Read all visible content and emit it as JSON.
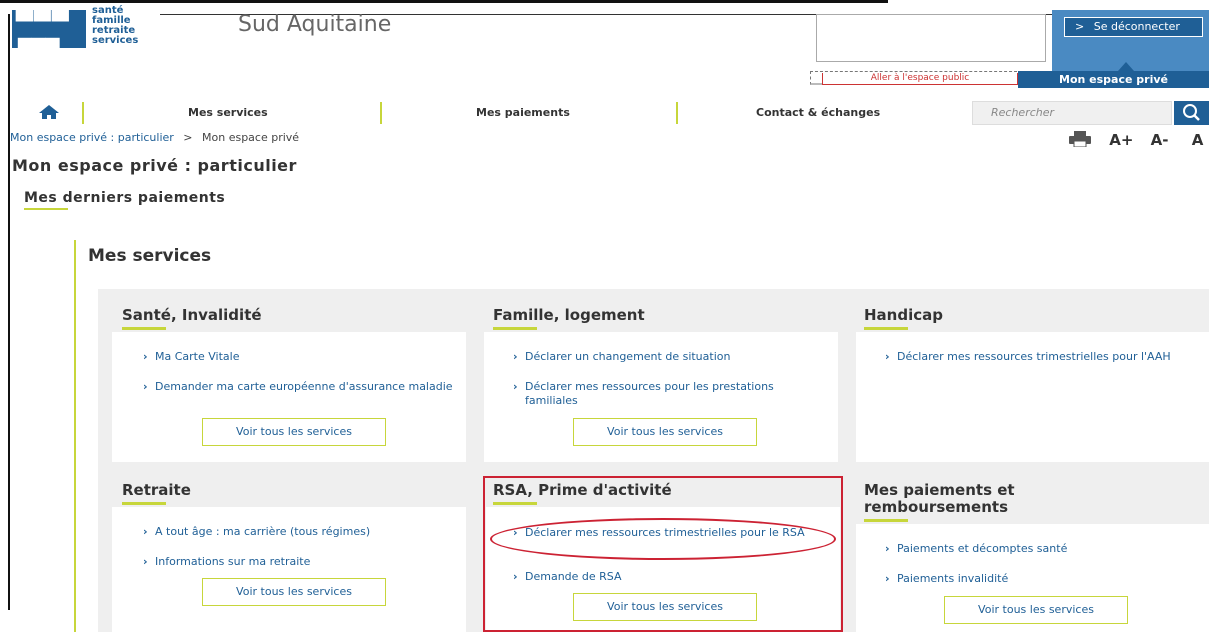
{
  "header": {
    "logo_tagline": [
      "santé",
      "famille",
      "retraite",
      "services"
    ],
    "site_title": "Sud Aquitaine",
    "public_link": "Aller à l'espace public",
    "logout_label": "Se déconnecter",
    "private_space": "Mon espace privé"
  },
  "nav": {
    "items": [
      "Mes services",
      "Mes paiements",
      "Contact & échanges"
    ],
    "search_placeholder": "Rechercher"
  },
  "breadcrumb": {
    "parent": "Mon espace privé : particulier",
    "separator": ">",
    "current": "Mon espace privé"
  },
  "tools": {
    "larger": "A+",
    "smaller": "A-",
    "reset": "A"
  },
  "page": {
    "title": "Mon espace privé : particulier",
    "last_payments": "Mes derniers paiements",
    "services_heading": "Mes services"
  },
  "cards": [
    {
      "title": "Santé, Invalidité",
      "links": [
        "Ma Carte Vitale",
        "Demander ma carte européenne d'assurance maladie"
      ],
      "button": "Voir tous les services"
    },
    {
      "title": "Famille, logement",
      "links": [
        "Déclarer un changement de situation",
        "Déclarer mes ressources pour les prestations familiales"
      ],
      "button": "Voir tous les services"
    },
    {
      "title": "Handicap",
      "links": [
        "Déclarer mes ressources trimestrielles pour l'AAH"
      ],
      "button": ""
    },
    {
      "title": "Retraite",
      "links": [
        "A tout âge : ma carrière (tous régimes)",
        "Informations sur ma retraite"
      ],
      "button": "Voir tous les services"
    },
    {
      "title": "RSA, Prime d'activité",
      "links": [
        "Déclarer mes ressources trimestrielles pour le RSA",
        "Demande de RSA"
      ],
      "button": "Voir tous les services"
    },
    {
      "title": "Mes paiements et remboursements",
      "links": [
        "Paiements et décomptes santé",
        "Paiements invalidité"
      ],
      "button": "Voir tous les services"
    }
  ],
  "colors": {
    "brand_blue": "#1f5f96",
    "accent_green": "#c7d63b",
    "highlight_red": "#cc2233"
  }
}
